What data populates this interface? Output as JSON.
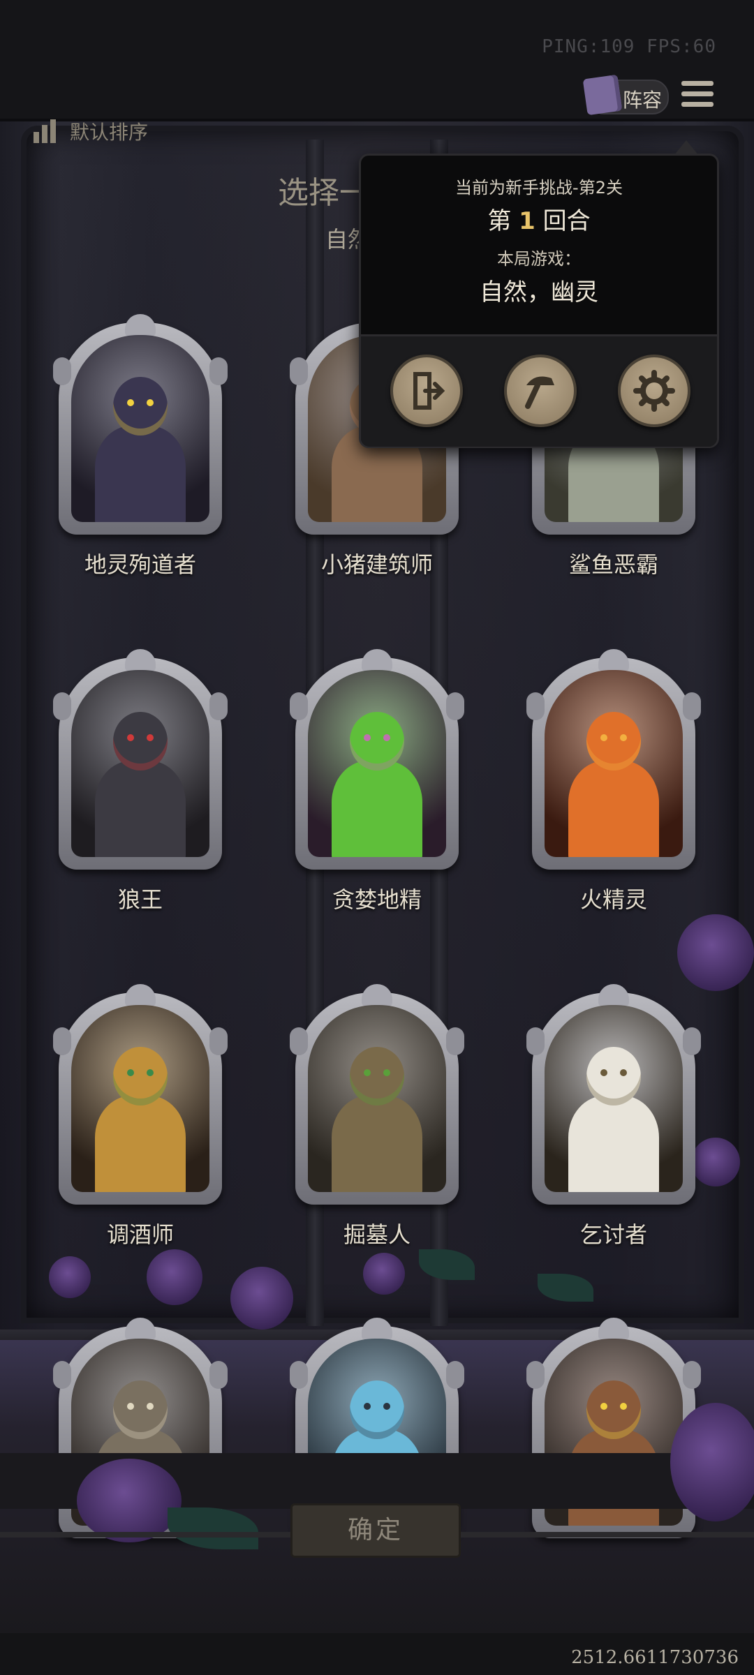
{
  "status": {
    "ping_fps": "PING:109 FPS:60"
  },
  "topbar": {
    "lineup_label": "阵容"
  },
  "sort": {
    "label": "默认排序"
  },
  "header": {
    "title": "选择一",
    "subtitle": "自然"
  },
  "popup": {
    "stage": "当前为新手挑战-第2关",
    "round_prefix": "第",
    "round_number": "1",
    "round_suffix": "回合",
    "game_label": "本局游戏：",
    "tribes": "自然，幽灵"
  },
  "heroes": [
    {
      "name": "地灵殉道者",
      "palette": [
        "#1e1b26",
        "#3a3650",
        "#f2d240"
      ]
    },
    {
      "name": "小猪建筑师",
      "palette": [
        "#4a3a2a",
        "#8a6a50",
        "#c99a7a"
      ]
    },
    {
      "name": "鲨鱼恶霸",
      "palette": [
        "#3a3a30",
        "#9aa090",
        "#e8e0c8"
      ]
    },
    {
      "name": "狼王",
      "palette": [
        "#1e1c20",
        "#3c3a42",
        "#d03a3a"
      ]
    },
    {
      "name": "贪婪地精",
      "palette": [
        "#2a1c2a",
        "#5fbf3a",
        "#c070b0"
      ]
    },
    {
      "name": "火精灵",
      "palette": [
        "#3a1a10",
        "#e0702a",
        "#f2b040"
      ]
    },
    {
      "name": "调酒师",
      "palette": [
        "#2a2018",
        "#c0903a",
        "#3a8a4a"
      ]
    },
    {
      "name": "掘墓人",
      "palette": [
        "#2a2620",
        "#7a6a4a",
        "#5aa03a"
      ]
    },
    {
      "name": "乞讨者",
      "palette": [
        "#2a241c",
        "#e8e4da",
        "#6a5a3a"
      ]
    },
    {
      "name": "",
      "palette": [
        "#2a2420",
        "#7a7060",
        "#e0d8c0"
      ]
    },
    {
      "name": "",
      "palette": [
        "#1e2830",
        "#6ab8d8",
        "#2a3440"
      ]
    },
    {
      "name": "",
      "palette": [
        "#2a2420",
        "#8a5a3a",
        "#f0d040"
      ]
    }
  ],
  "confirm": {
    "label": "确定"
  },
  "version": "2512.6611730736",
  "colors": {
    "accent": "#e9c46a",
    "popup_bg": "#0b0b0c",
    "button_tan": "#b9a88c",
    "rose": "#6c4d92"
  }
}
